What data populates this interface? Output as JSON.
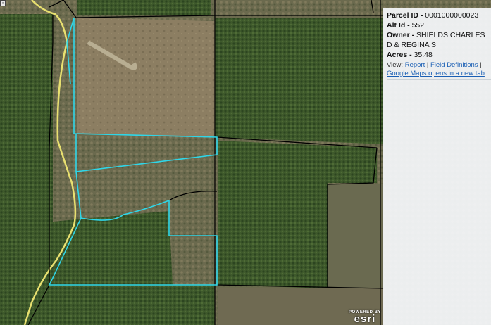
{
  "popup": {
    "parcel_id_label": "Parcel ID -",
    "parcel_id_value": "0001000000023",
    "alt_id_label": "Alt Id -",
    "alt_id_value": "552",
    "owner_label": "Owner -",
    "owner_value": "SHIELDS CHARLES D & REGINA S",
    "acres_label": "Acres -",
    "acres_value": "35.48",
    "view_label": "View:",
    "report_link": "Report",
    "field_definitions_link": "Field Definitions",
    "google_maps_link": "Google Maps opens in a new tab"
  },
  "attribution": {
    "powered_by": "POWERED BY",
    "logo": "esri"
  },
  "colors": {
    "parcel_lines": "#000000",
    "selected_parcel": "#2fd6e8",
    "road": "#e8e070"
  }
}
